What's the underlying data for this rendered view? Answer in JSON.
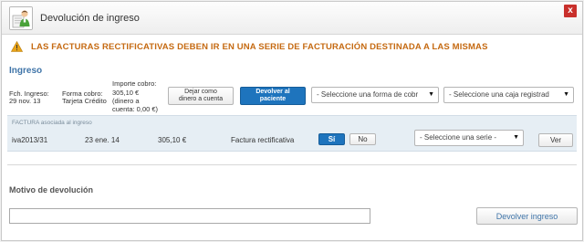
{
  "dialog": {
    "title": "Devolución de ingreso",
    "close_label": "x",
    "icon": "user-document-icon"
  },
  "warning": {
    "icon": "warning-triangle-icon",
    "text": "LAS FACTURAS RECTIFICATIVAS DEBEN IR EN UNA SERIE DE FACTURACIÓN DESTINADA A LAS MISMAS",
    "color": "#c56a12"
  },
  "ingreso": {
    "section_title": "Ingreso",
    "fecha_label": "Fch. Ingreso:",
    "fecha_value": "29 nov. 13",
    "forma_label": "Forma cobro:",
    "forma_value": "Tarjeta Crédito",
    "importe_lines": [
      "Importe cobro:",
      "305,10 €",
      "(dinero a",
      "cuenta: 0,00 €)"
    ],
    "dejar_button": [
      "Dejar como",
      "dinero a cuenta"
    ],
    "devolver_button": [
      "Devolver al",
      "paciente"
    ],
    "forma_select": "- Seleccione una forma de cobr",
    "caja_select": "- Seleccione una caja registrad"
  },
  "factura": {
    "header": "FACTURA asociada al ingreso",
    "numero": "iva2013/31",
    "fecha": "23 ene. 14",
    "importe": "305,10 €",
    "tipo": "Factura rectificativa",
    "si_label": "Sí",
    "no_label": "No",
    "serie_select": "- Seleccione una serie -",
    "ver_label": "Ver"
  },
  "motivo": {
    "label": "Motivo de devolución",
    "value": "",
    "submit_label": "Devolver ingreso"
  },
  "colors": {
    "accent": "#3f74a8",
    "primary_button": "#1e74bd",
    "panel": "#e6eef4",
    "close": "#c9302c"
  }
}
